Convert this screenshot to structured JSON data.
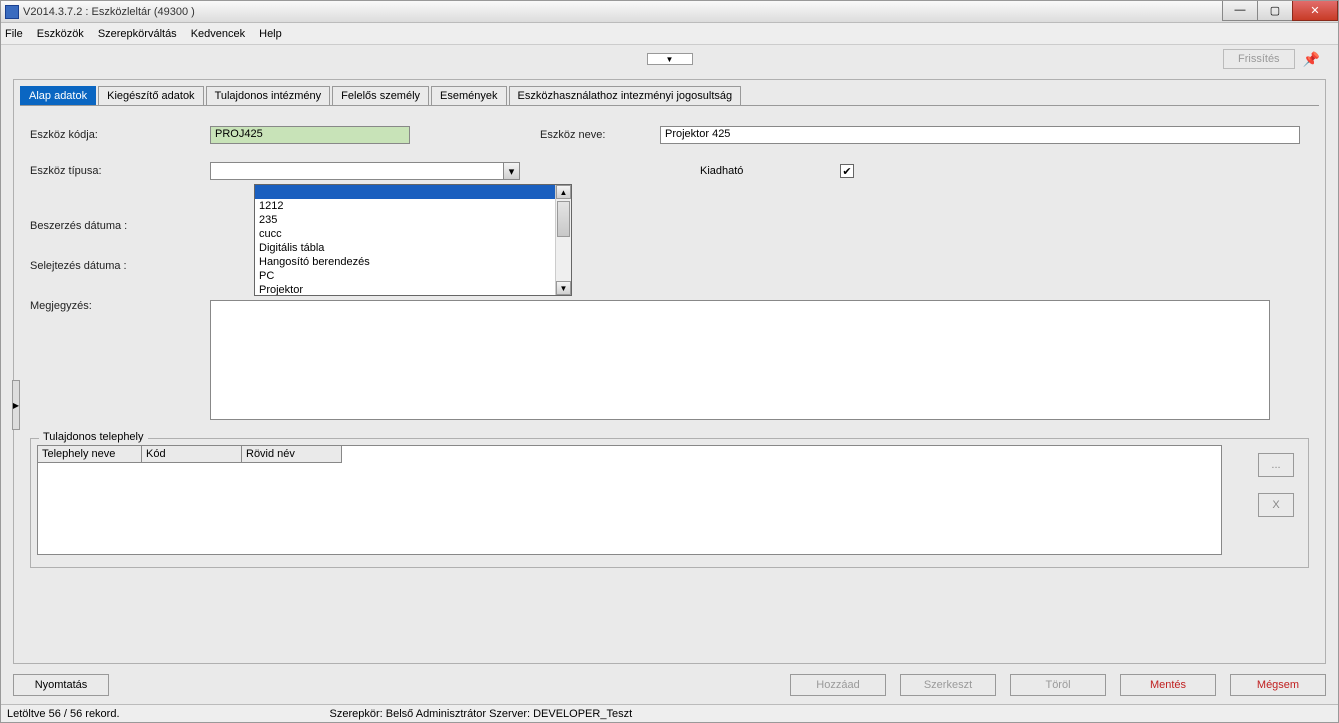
{
  "title": "V2014.3.7.2 : Eszközleltár (49300  )",
  "menu": {
    "file": "File",
    "tools": "Eszközök",
    "role": "Szerepkörváltás",
    "fav": "Kedvencek",
    "help": "Help"
  },
  "toolbar": {
    "refresh": "Frissítés"
  },
  "tabs": {
    "t0": "Alap adatok",
    "t1": "Kiegészítő adatok",
    "t2": "Tulajdonos intézmény",
    "t3": "Felelős személy",
    "t4": "Események",
    "t5": "Eszközhasználathoz intezményi jogosultság"
  },
  "labels": {
    "code": "Eszköz kódja:",
    "name": "Eszköz neve:",
    "type": "Eszköz típusa:",
    "loanable": "Kiadható",
    "acq": "Beszerzés dátuma :",
    "scrap": "Selejtezés dátuma :",
    "note": "Megjegyzés:"
  },
  "values": {
    "code": "PROJ425",
    "name": "Projektor 425"
  },
  "dropdown": {
    "items": [
      "",
      "1212",
      "235",
      "cucc",
      "Digitális tábla",
      "Hangosító berendezés",
      "PC",
      "Projektor"
    ]
  },
  "fieldset": {
    "legend": "Tulajdonos telephely",
    "cols": {
      "c0": "Telephely neve",
      "c1": "Kód",
      "c2": "Rövid név"
    },
    "ellipsis": "...",
    "x": "X"
  },
  "buttons": {
    "print": "Nyomtatás",
    "add": "Hozzáad",
    "edit": "Szerkeszt",
    "del": "Töröl",
    "save": "Mentés",
    "cancel": "Mégsem"
  },
  "status": {
    "left": "Letöltve 56 / 56 rekord.",
    "right": "Szerepkör: Belső Adminisztrátor   Szerver: DEVELOPER_Teszt"
  }
}
